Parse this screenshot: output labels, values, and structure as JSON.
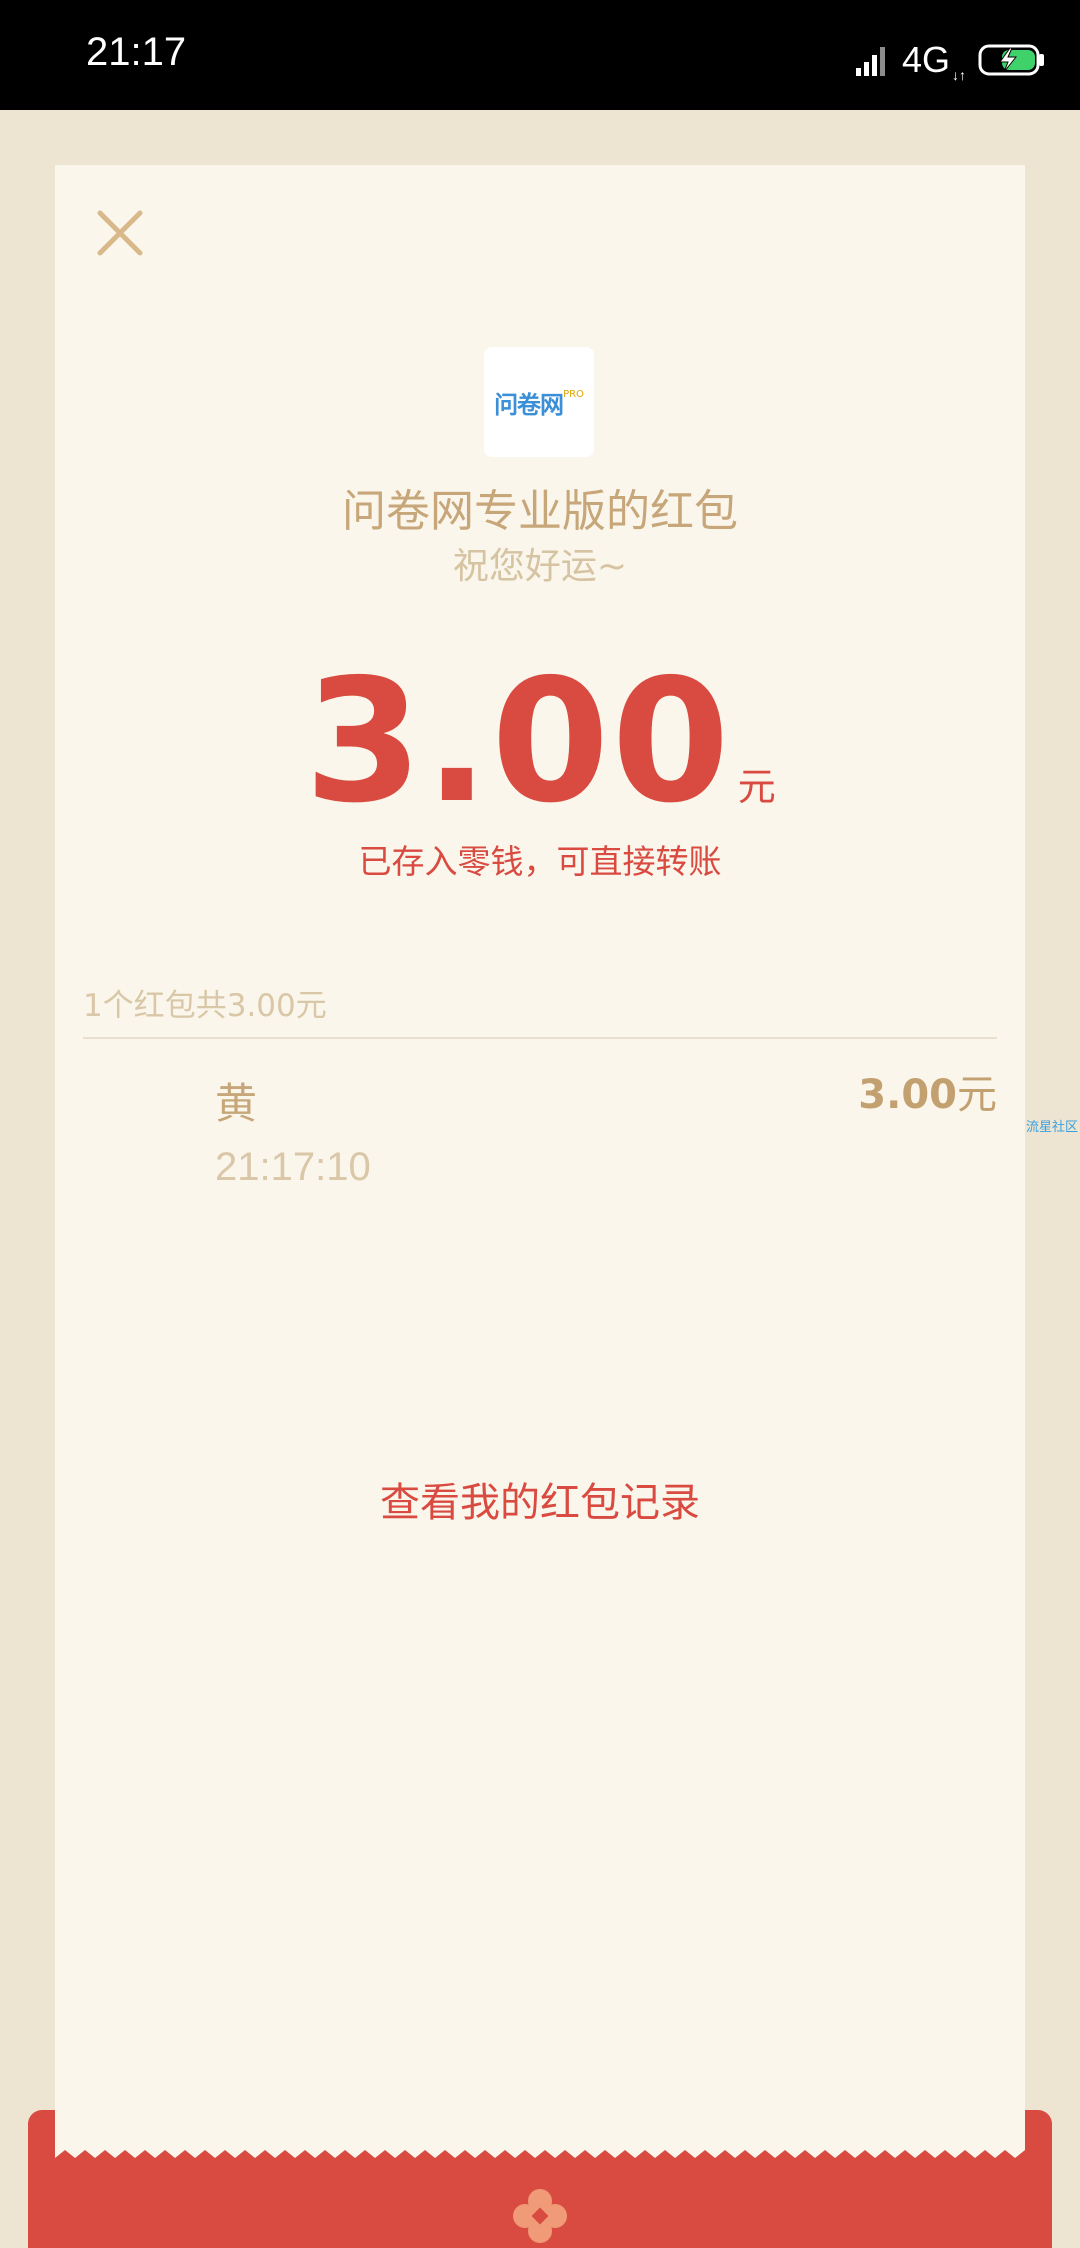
{
  "status_bar": {
    "time": "21:17",
    "network": "4G",
    "network_arrows": "↓↑",
    "icons": [
      "signal-icon",
      "battery-charging-icon"
    ]
  },
  "card": {
    "close_icon": "close-icon",
    "logo": {
      "text": "问卷网",
      "sub": "PRO"
    },
    "sender_title": "问卷网专业版的红包",
    "blessing": "祝您好运~",
    "amount": "3.00",
    "amount_unit": "元",
    "stored_note": "已存入零钱，可直接转账",
    "summary": "1个红包共3.00元",
    "receivers": [
      {
        "name": "黄",
        "time": "21:17:10",
        "amount": "3.00",
        "unit": "元"
      }
    ],
    "record_link": "查看我的红包记录"
  },
  "side_watermark": "流星社区",
  "colors": {
    "background": "#ede4d2",
    "card": "#faf6eb",
    "accent_red": "#d94a41",
    "gold_text": "#c7a77a"
  },
  "bottom_icon": "flower-icon"
}
